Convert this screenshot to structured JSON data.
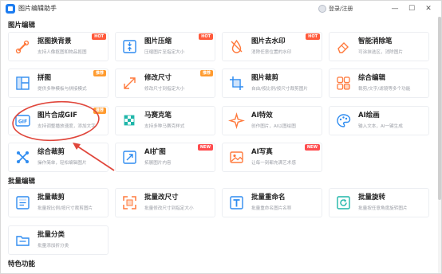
{
  "app": {
    "title": "图片编辑助手",
    "login_label": "登录/注册",
    "minimize": "—",
    "maximize": "☐",
    "close": "✕"
  },
  "sections": [
    {
      "title": "图片编辑"
    },
    {
      "title": "批量编辑"
    },
    {
      "title": "特色功能"
    }
  ],
  "tools": [
    {
      "name": "抠图换背景",
      "desc": "支持人像抠图和物品抠图",
      "badge": "HOT",
      "icon": "cutout-icon",
      "color": "#ff7a3d"
    },
    {
      "name": "图片压缩",
      "desc": "压缩图片至指定大小",
      "badge": "HOT",
      "icon": "compress-icon",
      "color": "#2f8cf0"
    },
    {
      "name": "图片去水印",
      "desc": "消除任意位置的水印",
      "badge": "HOT",
      "icon": "watermark-remove-icon",
      "color": "#ff7a3d"
    },
    {
      "name": "智能消除笔",
      "desc": "可涂抹选区，消除图片",
      "badge": "",
      "icon": "eraser-pen-icon",
      "color": "#ff7a3d"
    },
    {
      "name": "拼图",
      "desc": "提供多种模板与拼接模式",
      "badge": "推荐",
      "icon": "collage-icon",
      "color": "#2f8cf0"
    },
    {
      "name": "修改尺寸",
      "desc": "修改尺寸到指定大小",
      "badge": "推荐",
      "icon": "resize-icon",
      "color": "#ff7a3d"
    },
    {
      "name": "图片裁剪",
      "desc": "自由/按比例/按尺寸裁剪图片",
      "badge": "",
      "icon": "crop-icon",
      "color": "#2f8cf0"
    },
    {
      "name": "综合编辑",
      "desc": "裁剪/文字/滤镜等多个功能",
      "badge": "",
      "icon": "edit-suite-icon",
      "color": "#ff7a3d"
    },
    {
      "name": "图片合成GIF",
      "desc": "支持调整播放速度，添加文字",
      "badge": "推荐",
      "icon": "gif-icon",
      "color": "#2f8cf0"
    },
    {
      "name": "马赛克笔",
      "desc": "支持多种马赛克样式",
      "badge": "",
      "icon": "mosaic-icon",
      "color": "#1fb6a9"
    },
    {
      "name": "AI特效",
      "desc": "创作图片，AI以图绘图",
      "badge": "",
      "icon": "ai-effect-icon",
      "color": "#ff7a3d"
    },
    {
      "name": "AI绘画",
      "desc": "输入文本，AI一键生成",
      "badge": "",
      "icon": "ai-paint-icon",
      "color": "#2f8cf0"
    },
    {
      "name": "综合裁剪",
      "desc": "操作简单，轻松编辑图片",
      "badge": "",
      "icon": "smart-crop-icon",
      "color": "#2f8cf0"
    },
    {
      "name": "AI扩图",
      "desc": "拓展图片内容",
      "badge": "NEW",
      "icon": "ai-expand-icon",
      "color": "#2f8cf0"
    },
    {
      "name": "AI写真",
      "desc": "让每一刻都充满艺术感",
      "badge": "NEW",
      "icon": "ai-portrait-icon",
      "color": "#ff7a3d"
    }
  ],
  "batch_tools": [
    {
      "name": "批量裁剪",
      "desc": "批量按比例/按尺寸裁剪图片",
      "icon": "batch-crop-icon",
      "color": "#2f8cf0"
    },
    {
      "name": "批量改尺寸",
      "desc": "批量修改尺寸到指定大小",
      "icon": "batch-resize-icon",
      "color": "#ff7a3d"
    },
    {
      "name": "批量重命名",
      "desc": "批量重命名图片名称",
      "icon": "batch-rename-icon",
      "color": "#2f8cf0"
    },
    {
      "name": "批量旋转",
      "desc": "批量按任意角度旋转图片",
      "icon": "batch-rotate-icon",
      "color": "#1fb6a9"
    },
    {
      "name": "批量分类",
      "desc": "批量添加折分类",
      "icon": "batch-classify-icon",
      "color": "#2f8cf0"
    }
  ]
}
